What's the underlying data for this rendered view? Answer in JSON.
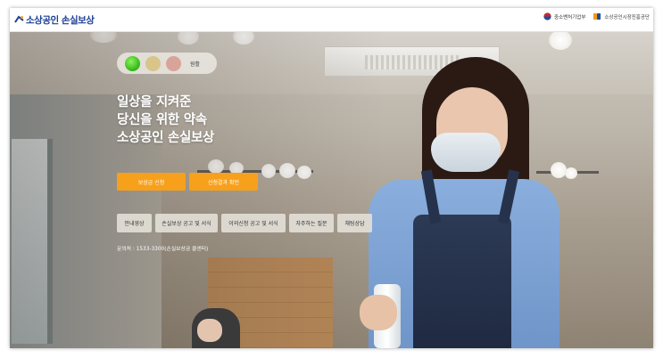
{
  "header": {
    "logo_text": "소상공인 손실보상",
    "partners": [
      {
        "name": "중소벤처기업부",
        "icon": "ministry-emblem-icon"
      },
      {
        "name": "소상공인시장진흥공단",
        "icon": "semas-logo-icon"
      }
    ]
  },
  "hero": {
    "status_lights": {
      "label": "원활",
      "active": "green",
      "colors": {
        "green": "#3ac31f",
        "yellow": "#d9c489",
        "red": "#d8a49a"
      }
    },
    "headline": [
      "일상을 지켜준",
      "당신을 위한 약속",
      "소상공인 손실보상"
    ],
    "primary_buttons": [
      "보상금 신청",
      "신청결과 확인"
    ],
    "secondary_buttons": [
      "안내영상",
      "손실보상 공고 및 서식",
      "이의신청 공고 및 서식",
      "자주하는 질문",
      "채팅상담"
    ],
    "contact": "문의처 : 1533-3300(손실보상금 콜센터)"
  },
  "colors": {
    "accent_orange": "#f7a01b",
    "brand_blue": "#1c3f95"
  }
}
